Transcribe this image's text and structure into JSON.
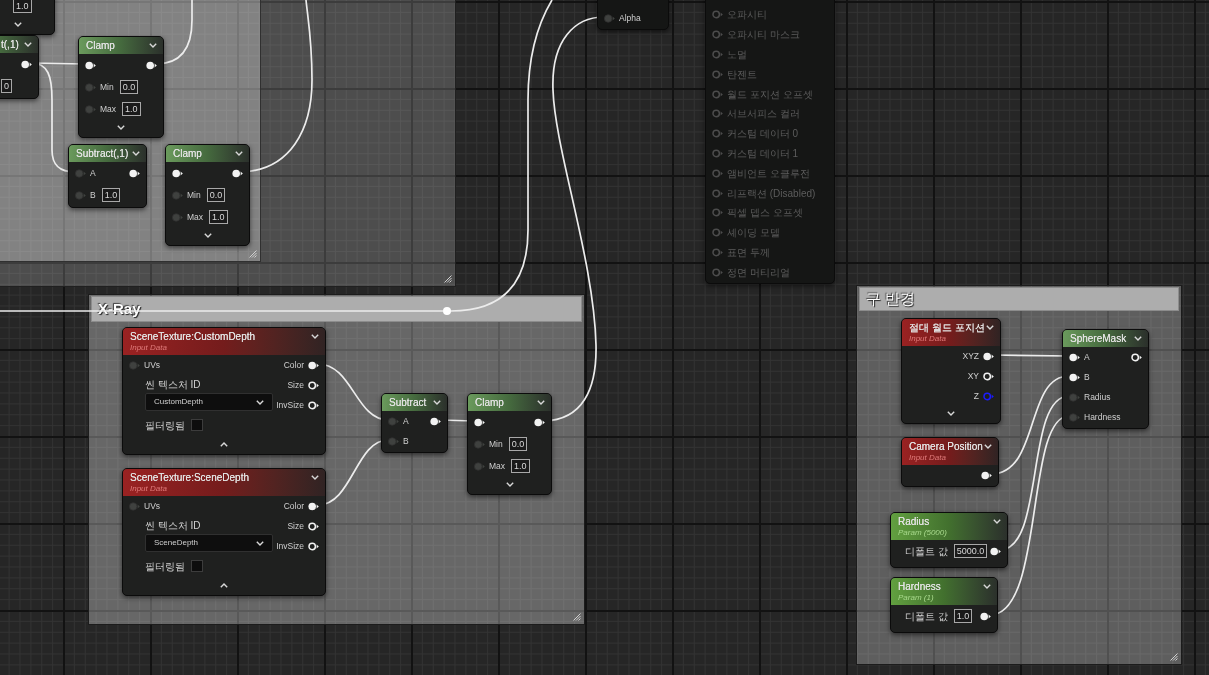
{
  "comments": [
    {
      "title": "X-Ray"
    },
    {
      "title": "구 반경"
    }
  ],
  "nodes": [
    {
      "kind": "function",
      "inputs": [
        {
          "kind": "value",
          "value": "1.0"
        }
      ],
      "expanded": false
    },
    {
      "kind": "function",
      "title": "t(,1)",
      "inputs": [
        {
          "kind": "value",
          "value": "0"
        }
      ],
      "outputs": [
        {
          "filled": true
        }
      ]
    },
    {
      "kind": "function",
      "title": "Clamp",
      "inputs": [
        {
          "kind": "pin",
          "filled": true
        },
        {
          "kind": "pin",
          "filled": false,
          "label": "Min",
          "value": "0.0"
        },
        {
          "kind": "pin",
          "filled": false,
          "label": "Max",
          "value": "1.0"
        }
      ],
      "outputs": [
        {
          "filled": true
        }
      ],
      "expanded": false
    },
    {
      "kind": "function",
      "title": "Subtract(,1)",
      "inputs": [
        {
          "kind": "pin",
          "filled": false,
          "label": "A"
        },
        {
          "kind": "pin",
          "filled": false,
          "label": "B",
          "value": "1.0"
        }
      ],
      "outputs": [
        {
          "filled": true
        }
      ]
    },
    {
      "kind": "function",
      "title": "Clamp",
      "inputs": [
        {
          "kind": "pin",
          "filled": true
        },
        {
          "kind": "pin",
          "filled": false,
          "label": "Min",
          "value": "0.0"
        },
        {
          "kind": "pin",
          "filled": false,
          "label": "Max",
          "value": "1.0"
        }
      ],
      "outputs": [
        {
          "filled": true
        }
      ],
      "expanded": false
    },
    {
      "kind": "result",
      "inputs": [
        {
          "kind": "pin",
          "filled": false,
          "label": "Alpha"
        }
      ]
    },
    {
      "kind": "result",
      "inputs": [
        {
          "kind": "pin",
          "filled": false,
          "label": "오파시티",
          "disabled": true
        },
        {
          "kind": "pin",
          "filled": false,
          "label": "오파시티 마스크",
          "disabled": true
        },
        {
          "kind": "pin",
          "filled": false,
          "label": "노멀",
          "disabled": true
        },
        {
          "kind": "pin",
          "filled": false,
          "label": "탄젠트",
          "disabled": true
        },
        {
          "kind": "pin",
          "filled": false,
          "label": "월드 포지션 오프셋",
          "disabled": true
        },
        {
          "kind": "pin",
          "filled": false,
          "label": "서브서피스 컬러",
          "disabled": true
        },
        {
          "kind": "pin",
          "filled": false,
          "label": "커스텀 데이터 0",
          "disabled": true
        },
        {
          "kind": "pin",
          "filled": false,
          "label": "커스텀 데이터 1",
          "disabled": true
        },
        {
          "kind": "pin",
          "filled": false,
          "label": "앰비언트 오클루전",
          "disabled": true
        },
        {
          "kind": "pin",
          "filled": false,
          "label": "리프랙션 (Disabled)",
          "disabled": true
        },
        {
          "kind": "pin",
          "filled": false,
          "label": "픽셀 뎁스 오프셋",
          "disabled": true
        },
        {
          "kind": "pin",
          "filled": false,
          "label": "셰이딩 모델",
          "disabled": true
        },
        {
          "kind": "pin",
          "filled": false,
          "label": "표면 두께",
          "disabled": true
        },
        {
          "kind": "pin",
          "filled": false,
          "label": "정면 머티리얼",
          "disabled": true
        }
      ]
    },
    {
      "kind": "input",
      "title": "SceneTexture:CustomDepth",
      "subtitle": "Input Data",
      "inputs": [
        {
          "kind": "pin",
          "filled": false,
          "label": "UVs"
        },
        {
          "kind": "property",
          "label": "씬 텍스처 ID"
        },
        {
          "kind": "dropdown",
          "value": "CustomDepth"
        },
        {
          "kind": "checkbox",
          "label": "필터링됨",
          "checked": false
        }
      ],
      "outputs": [
        {
          "label": "Color",
          "filled": true
        },
        {
          "label": "Size",
          "filled": false
        },
        {
          "label": "InvSize",
          "filled": false
        }
      ],
      "expanded": true
    },
    {
      "kind": "input",
      "title": "SceneTexture:SceneDepth",
      "subtitle": "Input Data",
      "inputs": [
        {
          "kind": "pin",
          "filled": false,
          "label": "UVs"
        },
        {
          "kind": "property",
          "label": "씬 텍스처 ID"
        },
        {
          "kind": "dropdown",
          "value": "SceneDepth"
        },
        {
          "kind": "checkbox",
          "label": "필터링됨",
          "checked": false
        }
      ],
      "outputs": [
        {
          "label": "Color",
          "filled": true
        },
        {
          "label": "Size",
          "filled": false
        },
        {
          "label": "InvSize",
          "filled": false
        }
      ],
      "expanded": true
    },
    {
      "kind": "function",
      "title": "Subtract",
      "inputs": [
        {
          "kind": "pin",
          "filled": false,
          "label": "A"
        },
        {
          "kind": "pin",
          "filled": false,
          "label": "B"
        }
      ],
      "outputs": [
        {
          "filled": true
        }
      ]
    },
    {
      "kind": "function",
      "title": "Clamp",
      "inputs": [
        {
          "kind": "pin",
          "filled": true
        },
        {
          "kind": "pin",
          "filled": false,
          "label": "Min",
          "value": "0.0"
        },
        {
          "kind": "pin",
          "filled": false,
          "label": "Max",
          "value": "1.0"
        }
      ],
      "outputs": [
        {
          "filled": true
        }
      ],
      "expanded": false
    },
    {
      "kind": "input",
      "title": "절대 월드 포지션",
      "subtitle": "Input Data",
      "outputs": [
        {
          "label": "XYZ",
          "filled": true
        },
        {
          "label": "XY",
          "filled": false
        },
        {
          "label": "Z",
          "filled": false,
          "color": "#1c1cff"
        }
      ],
      "expanded": false
    },
    {
      "kind": "input",
      "title": "Camera Position",
      "subtitle": "Input Data",
      "outputs": [
        {
          "filled": true
        }
      ]
    },
    {
      "kind": "parameter",
      "title": "Radius",
      "subtitle": "Param (5000)",
      "inputs": [
        {
          "kind": "value",
          "label": "디폴트 값",
          "value": "5000.0"
        }
      ],
      "outputs": [
        {
          "filled": true
        }
      ]
    },
    {
      "kind": "parameter",
      "title": "Hardness",
      "subtitle": "Param (1)",
      "inputs": [
        {
          "kind": "value",
          "label": "디폴트 값",
          "value": "1.0"
        }
      ],
      "outputs": [
        {
          "filled": true
        }
      ]
    },
    {
      "kind": "function",
      "title": "SphereMask",
      "inputs": [
        {
          "kind": "pin",
          "filled": true,
          "label": "A"
        },
        {
          "kind": "pin",
          "filled": true,
          "label": "B"
        },
        {
          "kind": "pin",
          "filled": false,
          "label": "Radius"
        },
        {
          "kind": "pin",
          "filled": false,
          "label": "Hardness"
        }
      ],
      "outputs": [
        {
          "filled": false
        }
      ]
    }
  ]
}
